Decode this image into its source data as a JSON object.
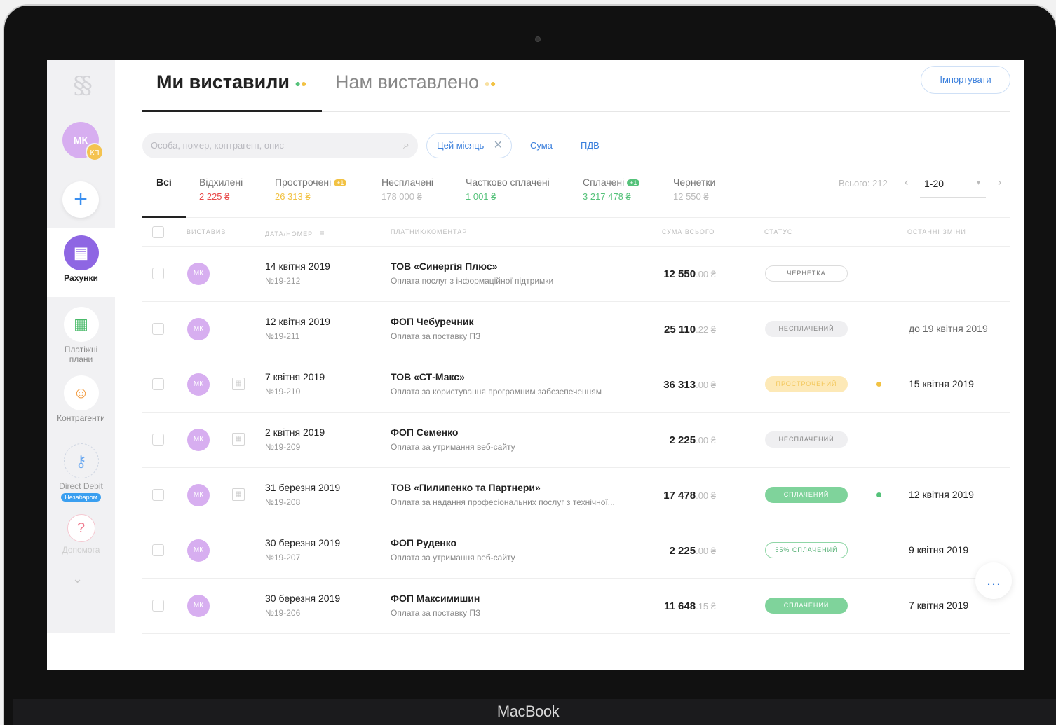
{
  "device": {
    "brand": "MacBook"
  },
  "sidebar": {
    "user_initials": "МК",
    "user_badge": "КП",
    "add_symbol": "+",
    "items": [
      {
        "label": "Рахунки"
      },
      {
        "label": "Платіжні плани"
      },
      {
        "label": "Контрагенти"
      },
      {
        "label": "Direct Debit",
        "badge": "Незабаром"
      },
      {
        "label": "Допомога"
      }
    ]
  },
  "header": {
    "tabs": [
      {
        "label": "Ми виставили"
      },
      {
        "label": "Нам виставлено"
      }
    ],
    "import_label": "Імпортувати"
  },
  "filters": {
    "search_placeholder": "Особа, номер, контрагент, опис",
    "chip_label": "Цей місяць",
    "links": [
      "Сума",
      "ПДВ"
    ]
  },
  "status_tabs": [
    {
      "label": "Всі",
      "amount": "",
      "count": ""
    },
    {
      "label": "Відхилені",
      "amount": "2 225 ₴",
      "count": ""
    },
    {
      "label": "Прострочені",
      "amount": "26 313 ₴",
      "count": "+1"
    },
    {
      "label": "Несплачені",
      "amount": "178 000 ₴",
      "count": ""
    },
    {
      "label": "Частково сплачені",
      "amount": "1 001 ₴",
      "count": ""
    },
    {
      "label": "Сплачені",
      "amount": "3 217 478 ₴",
      "count": "+1"
    },
    {
      "label": "Чернетки",
      "amount": "12 550 ₴",
      "count": ""
    }
  ],
  "pagination": {
    "total": "Всього: 212",
    "range": "1-20"
  },
  "table": {
    "headers": [
      "ВИСТАВИВ",
      "ДАТА/НОМЕР",
      "ПЛАТНИК/КОМЕНТАР",
      "СУМА ВСЬОГО",
      "СТАТУС",
      "ОСТАННІ ЗМІНИ"
    ],
    "rows": [
      {
        "initials": "МК",
        "date": "14 квітня 2019",
        "number": "№19-212",
        "payer": "ТОВ «Синергія Плюс»",
        "comment": "Оплата послуг з інформаційної підтримки",
        "sum": "12 550",
        "decimals": ".00 ₴",
        "status": "ЧЕРНЕТКА",
        "changed": ""
      },
      {
        "initials": "МК",
        "date": "12 квітня 2019",
        "number": "№19-211",
        "payer": "ФОП Чебуречник",
        "comment": "Оплата за поставку ПЗ",
        "sum": "25 110",
        "decimals": ".22 ₴",
        "status": "НЕСПЛАЧЕНИЙ",
        "changed": "до 19 квітня 2019"
      },
      {
        "initials": "МК",
        "date": "7 квітня 2019",
        "number": "№19-210",
        "payer": "ТОВ «СТ-Макс»",
        "comment": "Оплата за користування програмним забезепеченням",
        "sum": "36 313",
        "decimals": ".00 ₴",
        "status": "ПРОСТРОЧЕНИЙ",
        "changed": "15 квітня 2019"
      },
      {
        "initials": "МК",
        "date": "2 квітня 2019",
        "number": "№19-209",
        "payer": "ФОП Семенко",
        "comment": "Оплата за утримання веб-сайту",
        "sum": "2 225",
        "decimals": ".00 ₴",
        "status": "НЕСПЛАЧЕНИЙ",
        "changed": ""
      },
      {
        "initials": "МК",
        "date": "31 березня 2019",
        "number": "№19-208",
        "payer": "ТОВ «Пилипенко та Партнери»",
        "comment": "Оплата за надання професіональних послуг з технічної...",
        "sum": "17 478",
        "decimals": ".00 ₴",
        "status": "СПЛАЧЕНИЙ",
        "changed": "12 квітня 2019"
      },
      {
        "initials": "МК",
        "date": "30 березня 2019",
        "number": "№19-207",
        "payer": "ФОП Руденко",
        "comment": "Оплата за утримання веб-сайту",
        "sum": "2 225",
        "decimals": ".00 ₴",
        "status": "55% СПЛАЧЕНИЙ",
        "changed": "9 квітня 2019"
      },
      {
        "initials": "МК",
        "date": "30 березня 2019",
        "number": "№19-206",
        "payer": "ФОП Максимишин",
        "comment": "Оплата за поставку ПЗ",
        "sum": "11 648",
        "decimals": ".15 ₴",
        "status": "СПЛАЧЕНИЙ",
        "changed": "7 квітня 2019"
      }
    ]
  },
  "colors": {
    "accent": "#3a7fdc",
    "overdue": "#f2c243",
    "paid": "#55c27a",
    "rejected": "#e84a4a",
    "purple": "#8e66e3"
  }
}
